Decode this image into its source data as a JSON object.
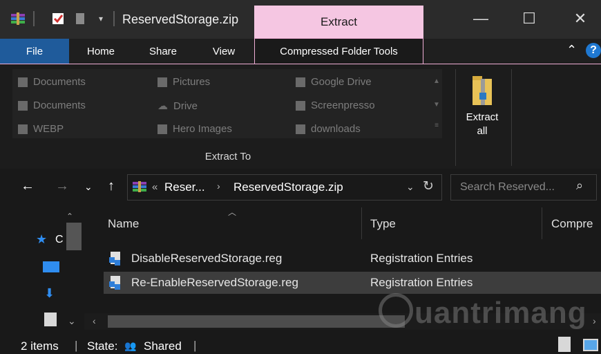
{
  "window": {
    "title": "ReservedStorage.zip",
    "context_tab": "Extract",
    "controls": {
      "minimize": "—",
      "maximize": "☐",
      "close": "✕"
    }
  },
  "ribbon": {
    "tabs": [
      "File",
      "Home",
      "Share",
      "View",
      "Compressed Folder Tools"
    ],
    "locations": [
      [
        "Documents",
        "Pictures",
        "Google Drive"
      ],
      [
        "Documents",
        "Drive",
        "Screenpresso"
      ],
      [
        "WEBP",
        "Hero Images",
        "downloads"
      ]
    ],
    "group_label": "Extract To",
    "extract_all": [
      "Extract",
      "all"
    ]
  },
  "address": {
    "prefix": "«",
    "crumbs": [
      "Reser...",
      "ReservedStorage.zip"
    ],
    "search_placeholder": "Search Reserved..."
  },
  "navpane": {
    "quick_access": "C"
  },
  "list": {
    "columns": [
      "Name",
      "Type",
      "Compre"
    ],
    "rows": [
      {
        "name": "DisableReservedStorage.reg",
        "type": "Registration Entries"
      },
      {
        "name": "Re-EnableReservedStorage.reg",
        "type": "Registration Entries"
      }
    ]
  },
  "status": {
    "items": "2 items",
    "state_label": "State:",
    "state_value": "Shared"
  },
  "watermark": "uantrimang",
  "colors": {
    "accent_pink": "#f5c6e2",
    "file_tab": "#1f5b9b",
    "selected_row": "#3d3d3d"
  }
}
